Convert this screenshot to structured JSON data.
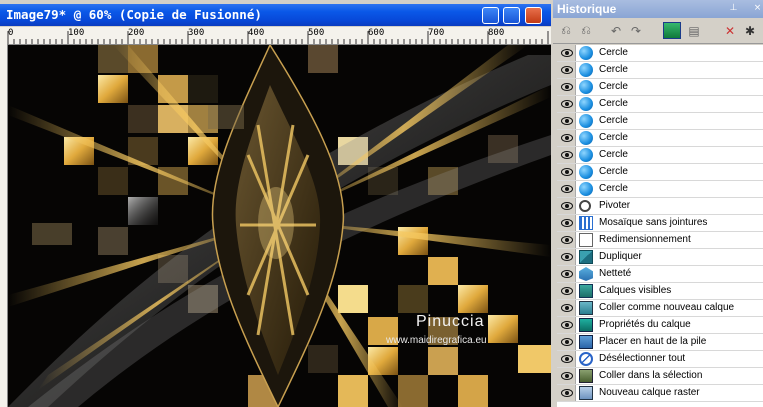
{
  "image_window": {
    "title": "Image79* @  60% (Copie de Fusionné)",
    "ruler_ticks": [
      "0",
      "100",
      "200",
      "300",
      "400",
      "500",
      "600",
      "700",
      "800"
    ]
  },
  "canvas": {
    "watermark": "Pinuccia",
    "watermark_url": "www.maidiregrafica.eu"
  },
  "history_panel": {
    "title": "Historique",
    "items": [
      {
        "label": "Cercle",
        "icon": "circle-icon"
      },
      {
        "label": "Cercle",
        "icon": "circle-icon"
      },
      {
        "label": "Cercle",
        "icon": "circle-icon"
      },
      {
        "label": "Cercle",
        "icon": "circle-icon"
      },
      {
        "label": "Cercle",
        "icon": "circle-icon"
      },
      {
        "label": "Cercle",
        "icon": "circle-icon"
      },
      {
        "label": "Cercle",
        "icon": "circle-icon"
      },
      {
        "label": "Cercle",
        "icon": "circle-icon"
      },
      {
        "label": "Cercle",
        "icon": "circle-icon"
      },
      {
        "label": "Pivoter",
        "icon": "rotate-icon"
      },
      {
        "label": "Mosaïque sans jointures",
        "icon": "seamless-tile-icon"
      },
      {
        "label": "Redimensionnement",
        "icon": "resize-icon"
      },
      {
        "label": "Dupliquer",
        "icon": "duplicate-icon"
      },
      {
        "label": "Netteté",
        "icon": "sharpen-icon"
      },
      {
        "label": "Calques visibles",
        "icon": "visible-layers-icon"
      },
      {
        "label": "Coller comme nouveau calque",
        "icon": "paste-layer-icon"
      },
      {
        "label": "Propriétés du calque",
        "icon": "layer-properties-icon"
      },
      {
        "label": "Placer en haut de la pile",
        "icon": "bring-to-top-icon"
      },
      {
        "label": "Désélectionner tout",
        "icon": "deselect-icon"
      },
      {
        "label": "Coller dans la sélection",
        "icon": "paste-selection-icon"
      },
      {
        "label": "Nouveau calque raster",
        "icon": "new-raster-layer-icon"
      }
    ]
  },
  "colors": {
    "titlebar_blue": "#0a58e8",
    "gold": "#e8b84a",
    "panel_title": "#8aa5d4"
  }
}
